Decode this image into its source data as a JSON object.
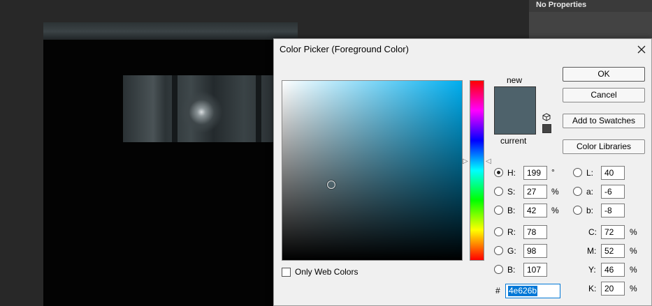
{
  "background": {
    "panel_title": "No Properties"
  },
  "dialog": {
    "title": "Color Picker (Foreground Color)",
    "buttons": {
      "ok": "OK",
      "cancel": "Cancel",
      "add_to_swatches": "Add to Swatches",
      "color_libraries": "Color Libraries"
    },
    "preview": {
      "new_label": "new",
      "current_label": "current",
      "new_color": "#4e626b",
      "current_color": "#4e626b"
    },
    "only_web_colors": {
      "label": "Only Web Colors",
      "checked": false
    },
    "hsb": {
      "h": {
        "label": "H:",
        "value": "199",
        "unit": "°",
        "selected": true
      },
      "s": {
        "label": "S:",
        "value": "27",
        "unit": "%"
      },
      "b": {
        "label": "B:",
        "value": "42",
        "unit": "%"
      }
    },
    "rgb": {
      "r": {
        "label": "R:",
        "value": "78"
      },
      "g": {
        "label": "G:",
        "value": "98"
      },
      "b": {
        "label": "B:",
        "value": "107"
      }
    },
    "lab": {
      "l": {
        "label": "L:",
        "value": "40"
      },
      "a": {
        "label": "a:",
        "value": "-6"
      },
      "b": {
        "label": "b:",
        "value": "-8"
      }
    },
    "cmyk": {
      "c": {
        "label": "C:",
        "value": "72",
        "unit": "%"
      },
      "m": {
        "label": "M:",
        "value": "52",
        "unit": "%"
      },
      "y": {
        "label": "Y:",
        "value": "46",
        "unit": "%"
      },
      "k": {
        "label": "K:",
        "value": "20",
        "unit": "%"
      }
    },
    "hex": {
      "hash": "#",
      "value": "4e626b"
    }
  }
}
